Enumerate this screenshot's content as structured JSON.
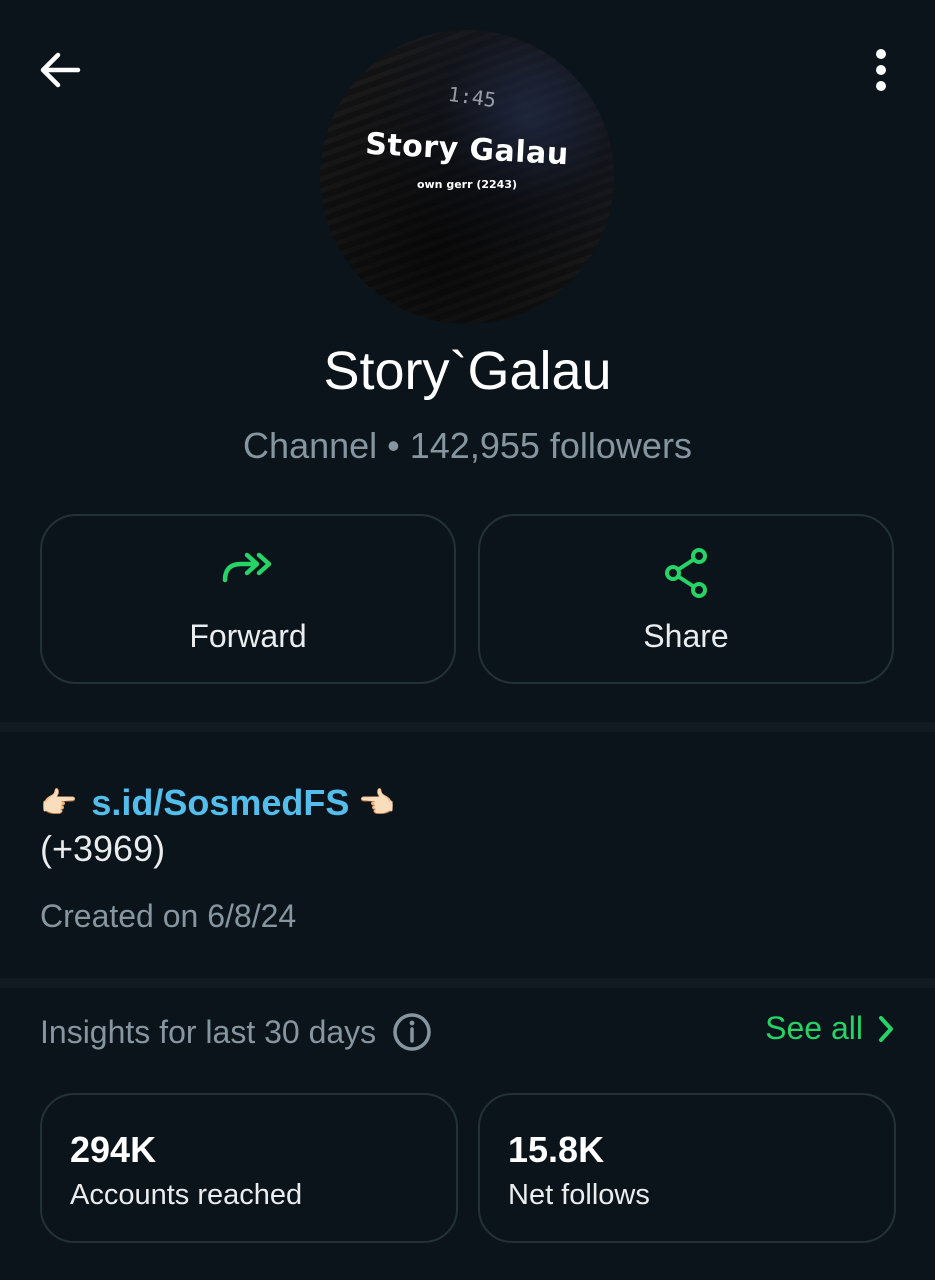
{
  "header": {
    "back_icon": "arrow-left-icon",
    "menu_icon": "more-vertical-icon"
  },
  "avatar": {
    "clock_text": "1:45",
    "title_text": "Story Galau",
    "subtitle_text": "own gerr (2243)"
  },
  "channel": {
    "name": "Story`Galau",
    "meta": "Channel • 142,955 followers"
  },
  "actions": [
    {
      "label": "Forward",
      "icon": "forward-icon"
    },
    {
      "label": "Share",
      "icon": "share-icon"
    }
  ],
  "description": {
    "hand_left": "👉🏻",
    "link": "s.id/SosmedFS",
    "hand_right": "👉🏻",
    "line2": "(+3969)",
    "created": "Created on 6/8/24"
  },
  "insights": {
    "title": "Insights for last 30 days",
    "see_all": "See all",
    "stats": [
      {
        "value": "294K",
        "label": "Accounts reached"
      },
      {
        "value": "15.8K",
        "label": "Net follows"
      }
    ]
  },
  "colors": {
    "background": "#0b141a",
    "accent_green": "#25d366",
    "link_blue": "#53bdeb",
    "muted_text": "#8696a0"
  }
}
